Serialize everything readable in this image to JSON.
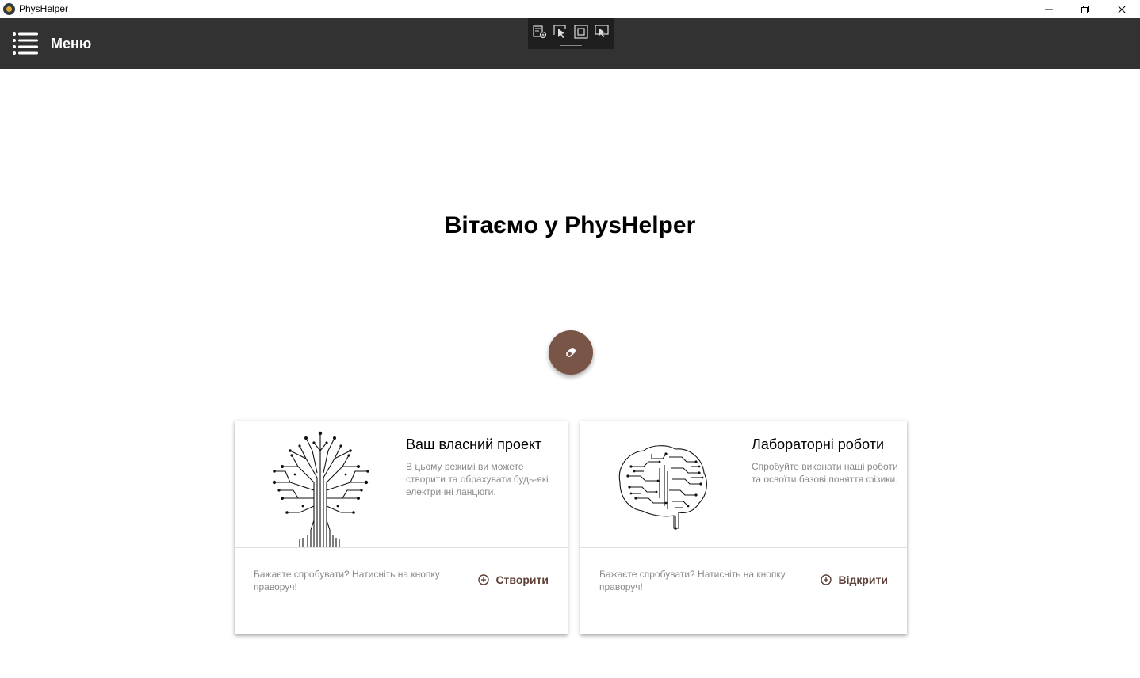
{
  "window": {
    "title": "PhysHelper",
    "icon": "app-logo-icon",
    "controls": [
      "minimize-icon",
      "restore-icon",
      "close-icon"
    ]
  },
  "appbar": {
    "menu_icon": "hamburger-menu-icon",
    "menu_label": "Меню",
    "background": "#323232"
  },
  "debug_toolbar": {
    "buttons": [
      "live-visual-tree-icon",
      "select-element-icon",
      "display-layout-adorners-icon",
      "track-focused-element-icon"
    ]
  },
  "main": {
    "welcome": "Вітаємо у PhysHelper",
    "fab_icon": "pill-icon",
    "fab_color": "#795548"
  },
  "cards": [
    {
      "image": "circuit-tree-image",
      "title": "Ваш власний проект",
      "description": "В цьому режимі ви можете створити та обрахувати будь-які електричні ланцюги.",
      "hint": "Бажаєте спробувати? Натисніть на кнопку праворуч!",
      "action_icon": "plus-circle-icon",
      "action_label": "Створити"
    },
    {
      "image": "circuit-brain-image",
      "title": "Лабораторні роботи",
      "description": "Спробуйте виконати наші роботи та освоїти базові поняття фізики.",
      "hint": "Бажаєте спробувати? Натисніть на кнопку праворуч!",
      "action_icon": "plus-circle-icon",
      "action_label": "Відкрити"
    }
  ]
}
